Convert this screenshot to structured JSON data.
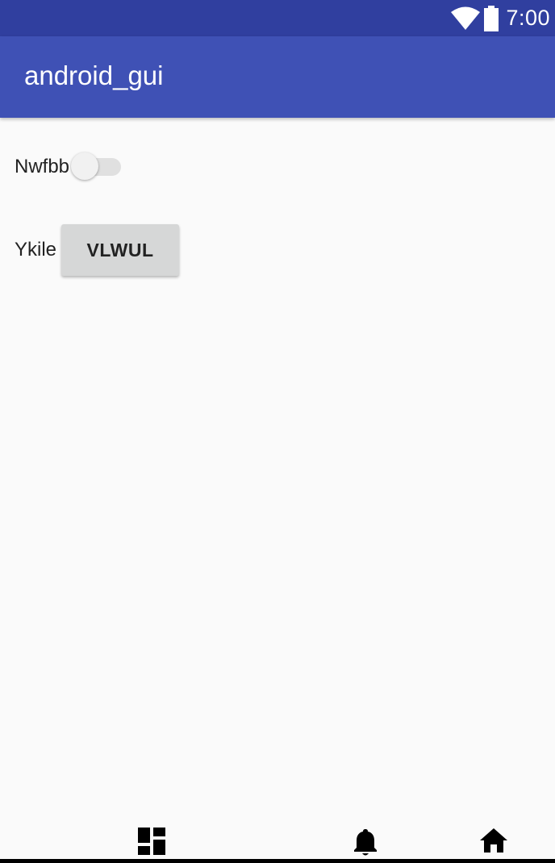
{
  "status_bar": {
    "time": "7:00",
    "icons": [
      "wifi-icon",
      "battery-icon"
    ],
    "color": "#303f9f"
  },
  "app_bar": {
    "title": "android_gui",
    "color": "#3f51b5"
  },
  "content": {
    "switch_row": {
      "label": "Nwfbb",
      "checked": false
    },
    "button_row": {
      "label": "Ykile",
      "button_label": "VLWUL"
    }
  },
  "nav_bar": {
    "icons": [
      "dashboard-icon",
      "bell-icon",
      "home-icon"
    ]
  }
}
